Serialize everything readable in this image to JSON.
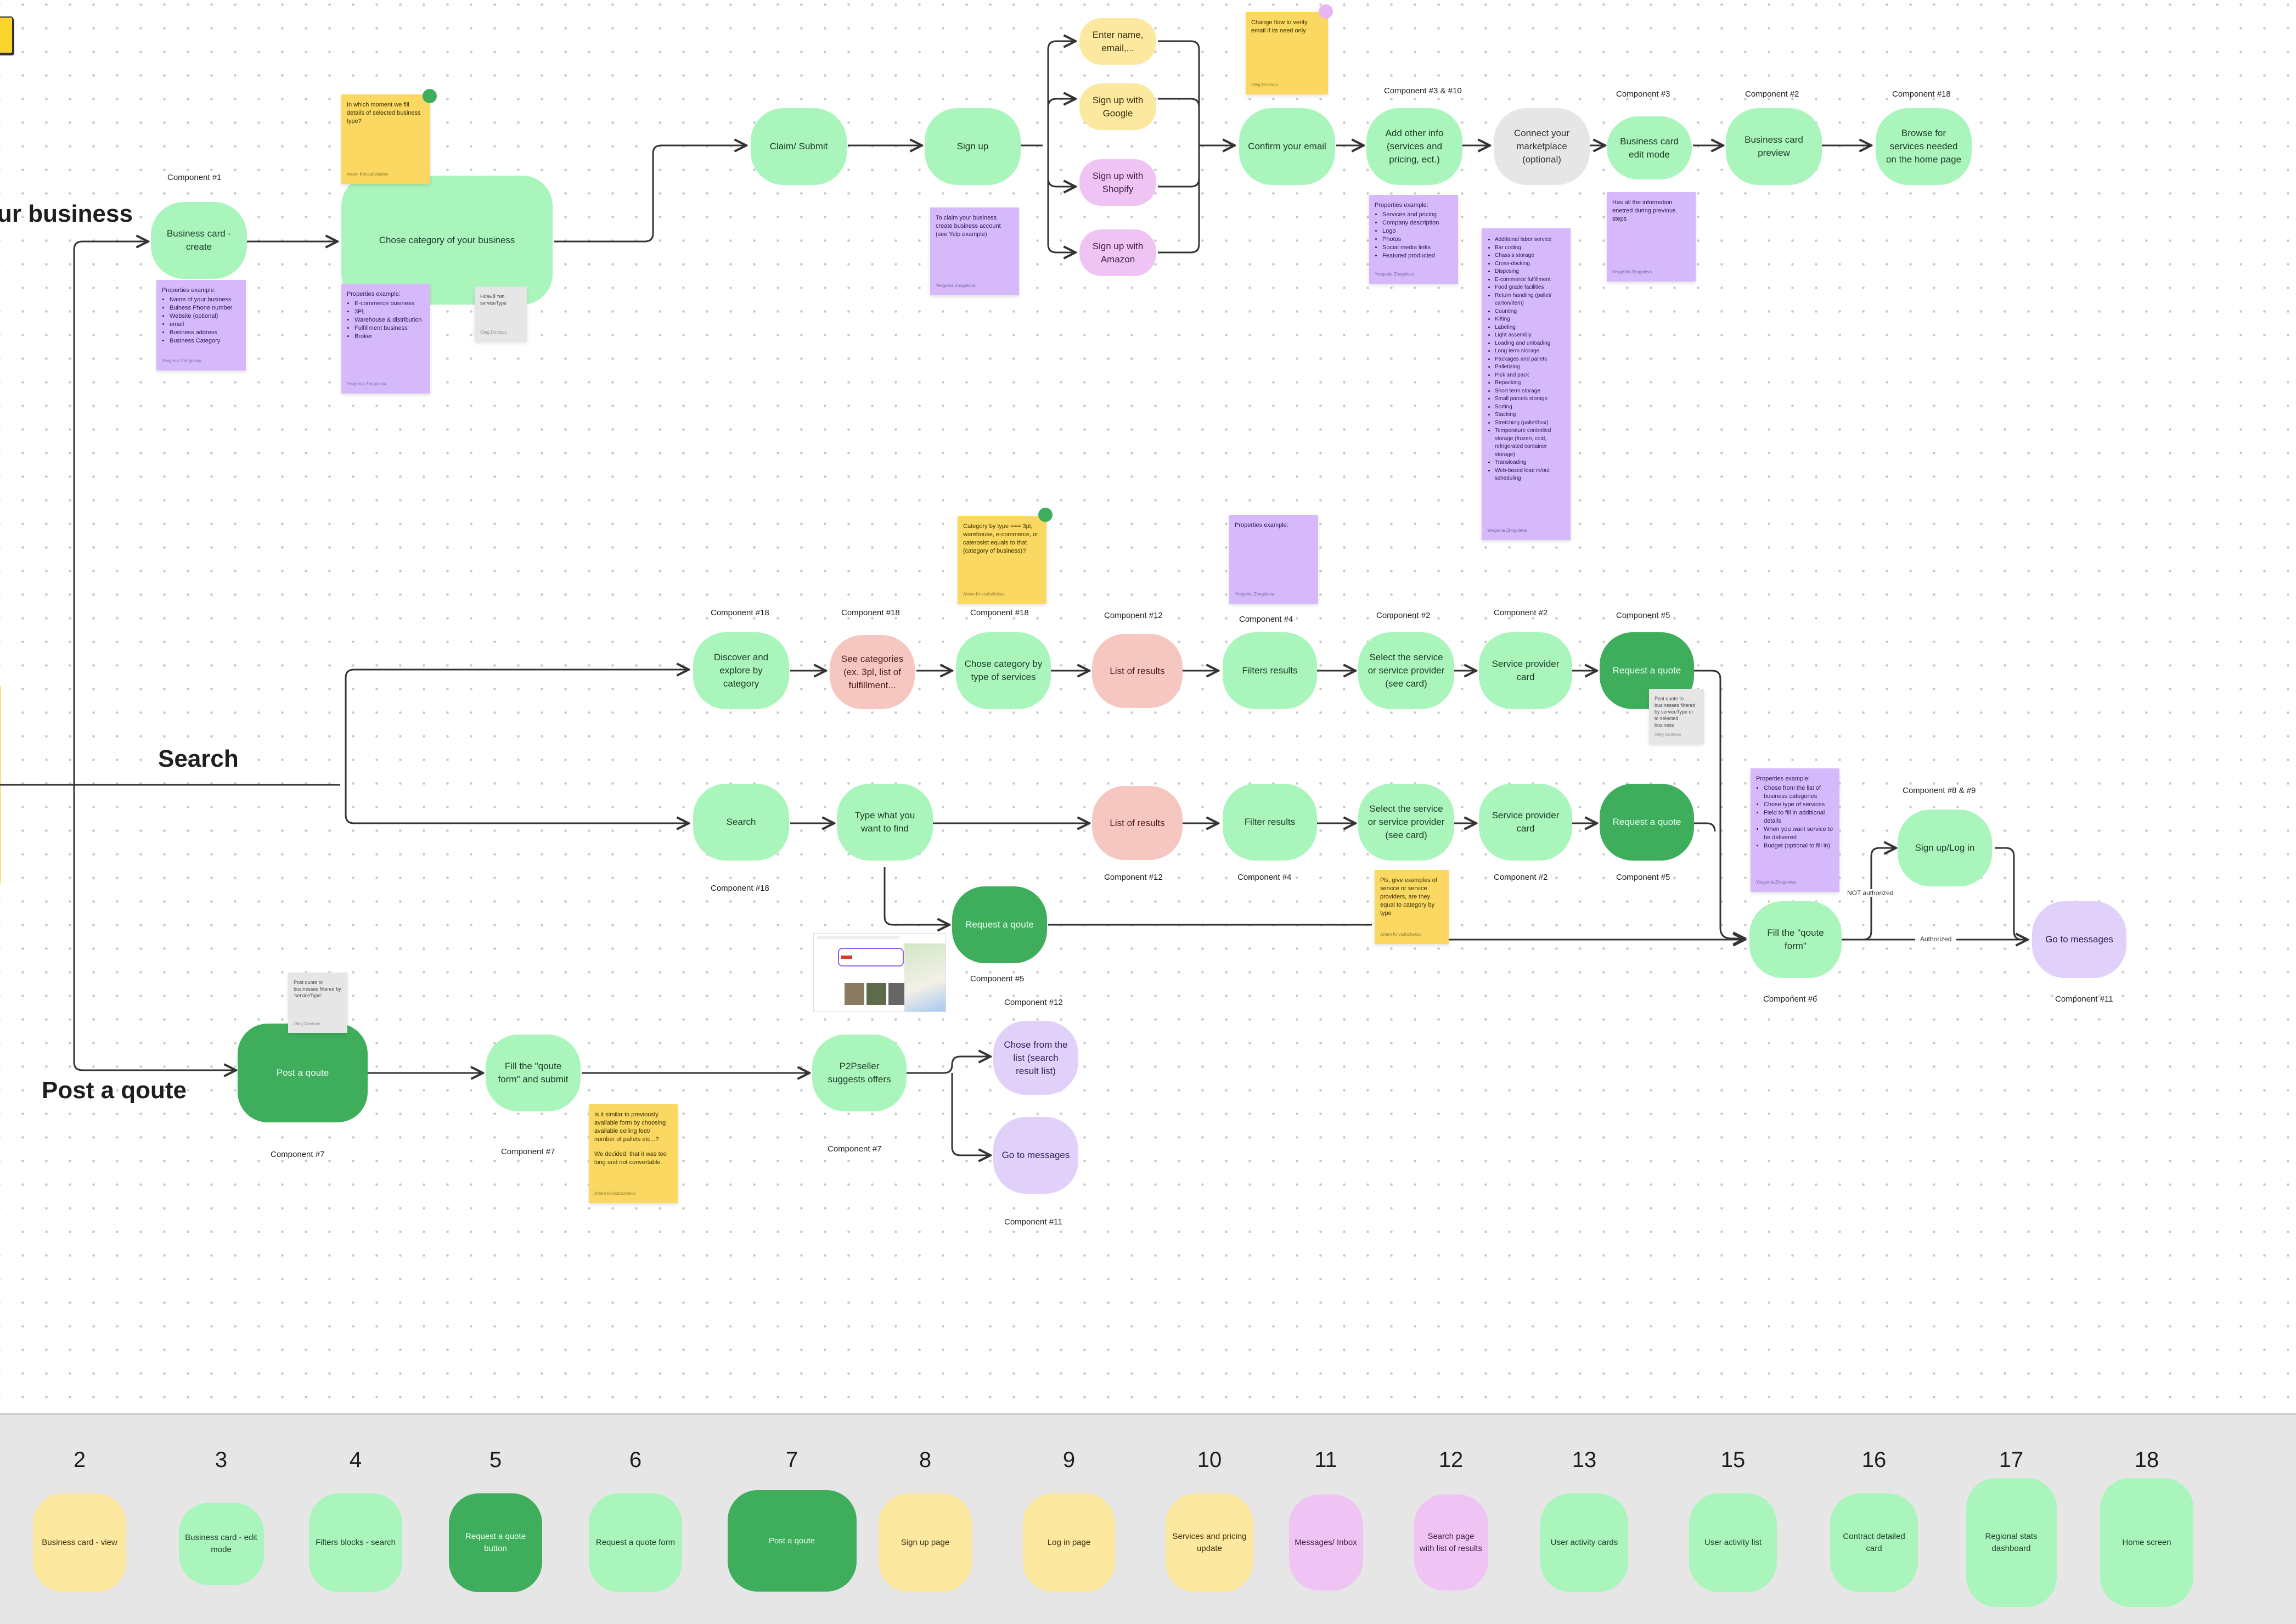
{
  "sections": {
    "claim": "ur business",
    "search": "Search",
    "post": "Post a qoute"
  },
  "flow_claim": {
    "nodes": [
      {
        "id": "bc-create",
        "label": "Business card - create",
        "component": "Component #1"
      },
      {
        "id": "chose-cat",
        "label": "Chose category of your business",
        "component": ""
      },
      {
        "id": "claim",
        "label": "Claim/ Submit",
        "component": ""
      },
      {
        "id": "signup",
        "label": "Sign up",
        "component": ""
      },
      {
        "id": "enter-name",
        "label": "Enter name, email,...",
        "component": ""
      },
      {
        "id": "google",
        "label": "Sign up with Google",
        "component": ""
      },
      {
        "id": "shopify",
        "label": "Sign up with Shopify",
        "component": ""
      },
      {
        "id": "amazon",
        "label": "Sign up with Amazon",
        "component": ""
      },
      {
        "id": "confirm",
        "label": "Confirm your email",
        "component": ""
      },
      {
        "id": "add-info",
        "label": "Add other info (services and pricing, ect.)",
        "component": "Component #3 & #10"
      },
      {
        "id": "marketplace",
        "label": "Connect your marketplace (optional)",
        "component": ""
      },
      {
        "id": "bc-edit",
        "label": "Business card edit mode",
        "component": "Component #3"
      },
      {
        "id": "bc-preview",
        "label": "Business card preview",
        "component": "Component #2"
      },
      {
        "id": "browse",
        "label": "Browse for services needed on the home page",
        "component": "Component #18"
      }
    ]
  },
  "flow_discover": {
    "nodes": [
      {
        "label": "Discover and explore by category",
        "component": "Component #18"
      },
      {
        "label": "See categories (ex. 3pl, list of fulfillment...",
        "component": "Component #18"
      },
      {
        "label": "Chose category by type of services",
        "component": "Component #18"
      },
      {
        "label": "List of results",
        "component": "Component #12"
      },
      {
        "label": "Filters results",
        "component": "Component #4"
      },
      {
        "label": "Select the service or service provider (see card)",
        "component": "Component #2"
      },
      {
        "label": "Service provider card",
        "component": "Component #2"
      },
      {
        "label": "Request a quote",
        "component": "Component #5"
      }
    ]
  },
  "flow_search": {
    "nodes": [
      {
        "label": "Search",
        "component": "Component #18"
      },
      {
        "label": "Type what you want to find",
        "component": ""
      },
      {
        "label": "List of results",
        "component": "Component #12"
      },
      {
        "label": "Filter results",
        "component": "Component #4"
      },
      {
        "label": "Select the service or service provider (see card)",
        "component": "Component #2"
      },
      {
        "label": "Service provider card",
        "component": "Component #2"
      },
      {
        "label": "Request a quote",
        "component": "Component #5"
      }
    ],
    "request_qoute": {
      "label": "Request a qoute",
      "component": "Component #5",
      "component2": "Component #12"
    },
    "fill_form": {
      "label": "Fill the \"qoute form\"",
      "component": "Component #6"
    },
    "signup_login": {
      "label": "Sign up/Log in",
      "component": "Component #8 & #9"
    },
    "go_messages": {
      "label": "Go to messages",
      "component": "Component #11"
    },
    "edge_not_auth": "NOT authorized",
    "edge_auth": "Authorized"
  },
  "flow_post": {
    "post": {
      "label": "Post a qoute",
      "component": "Component #7"
    },
    "fill": {
      "label": "Fill the \"qoute form\" and submit",
      "component": "Component #7"
    },
    "p2p": {
      "label": "P2Pseller suggests offers",
      "component": "Component #7"
    },
    "chose": {
      "label": "Chose from the list (search result list)",
      "component": "Component #12"
    },
    "messages": {
      "label": "Go to messages",
      "component": "Component #11"
    }
  },
  "stickies": {
    "q_moment": {
      "text": "In which moment we fill details of selected business type?",
      "author": "Artem Krivoshchekov"
    },
    "props_bc": {
      "title": "Properties example:",
      "items": [
        "Name of your business",
        "Buiness Phone number",
        "Website (optional)",
        "email",
        "Business address",
        "Business Category"
      ],
      "author": "Yevgenia Zhogoleva"
    },
    "props_cat": {
      "title": "Properties example:",
      "items": [
        "E-commerce business",
        "3PL",
        "Warehouse & distribution",
        "Fulfillment business",
        "Broker"
      ],
      "author": "Yevgenia Zhogoleva"
    },
    "grey_cat": {
      "text": "Новый тип serviceType",
      "author": "Oleg Dontsov"
    },
    "claim_note": {
      "text": "To claim your business create business account (see Yelp example)",
      "author": "Yevgenia Zhogoleva"
    },
    "verify_note": {
      "text": "Change flow to verify email if its need only",
      "author": "Oleg Dontsov"
    },
    "props_info": {
      "title": "Properties example:",
      "items": [
        "Services and pricing",
        "Company description",
        "Logo",
        "Photos",
        "Social media links",
        "Featured producted"
      ],
      "author": "Yevgenia Zhogoleva"
    },
    "services_list": {
      "items": [
        "Additional labor service",
        "Bar coding",
        "Chassis storage",
        "Cross-docking",
        "Disposing",
        "E-commerce fulfillment",
        "Food grade facilities",
        "Return handling (pallet/ carton/item)",
        "Counting",
        "Kitting",
        "Labeling",
        "Light assembly",
        "Loading and unloading",
        "Long term storage",
        "Packages and pallets",
        "Palletizing",
        "Pick and pack",
        "Repacking",
        "Short term storage",
        "Small parcels storage",
        "Sorting",
        "Stacking",
        "Stretching (pallet/box)",
        "Temperature controlled storage (frozen, cold, refrigerated container storage)",
        "Transloading",
        "Web-based load in/out scheduling"
      ],
      "author": "Yevgenia Zhogoleva"
    },
    "edit_note": {
      "text": "Has all the information enetred during previous steps",
      "author": "Yevgenia Zhogoleva"
    },
    "cat_type": {
      "text": "Category by type === 3pl, warehouse, e-commerce, or caterosist equals to that (category of business)?",
      "author": "Artem Krivoshchekov"
    },
    "props_filter": {
      "title": "Properties example:",
      "author": "Yevgenia Zhogoleva"
    },
    "grey_quote": {
      "text": "Post quote to businesses filtered by serviceType or to selected business",
      "author": "Oleg Dontsov"
    },
    "pls_examples": {
      "text": "Pls, give examples of service or service providers, are they equal to category by type",
      "author": "Artem Krivoshchekov"
    },
    "props_quote": {
      "title": "Properties example:",
      "items": [
        "Chose from the list of business categories",
        "Chose type of services",
        "Field to fill in additional details",
        "When you want service to be delivered",
        "Budget (optional to fill in)"
      ],
      "author": "Yevgenia Zhogoleva"
    },
    "grey_post": {
      "text": "Post quote to businesses filtered by 'serviceType'",
      "author": "Oleg Dontsov"
    },
    "similar_note": {
      "text": "Is it similar to previously available form by choosing available ceiling feet/ number of pallets etc...?",
      "text2": "We decided, that it was too long and not convertable.",
      "author": "Artem Krivoshchekov"
    }
  },
  "legend": [
    {
      "num": "2",
      "label": "Business card - view",
      "color": "yellow"
    },
    {
      "num": "3",
      "label": "Business card - edit mode",
      "color": "green"
    },
    {
      "num": "4",
      "label": "Filters blocks - search",
      "color": "green"
    },
    {
      "num": "5",
      "label": "Request a quote button",
      "color": "dark-green"
    },
    {
      "num": "6",
      "label": "Request a quote form",
      "color": "green"
    },
    {
      "num": "7",
      "label": "Post a qoute",
      "color": "dark-green"
    },
    {
      "num": "8",
      "label": "Sign up page",
      "color": "yellow"
    },
    {
      "num": "9",
      "label": "Log in page",
      "color": "yellow"
    },
    {
      "num": "10",
      "label": "Services and pricing update",
      "color": "yellow"
    },
    {
      "num": "11",
      "label": "Messages/ Inbox",
      "color": "pink"
    },
    {
      "num": "12",
      "label": "Search page with list of results",
      "color": "pink"
    },
    {
      "num": "13",
      "label": "User activity cards",
      "color": "green"
    },
    {
      "num": "15",
      "label": "User activity list",
      "color": "green"
    },
    {
      "num": "16",
      "label": "Contract detailed card",
      "color": "green"
    },
    {
      "num": "17",
      "label": "Regional stats dashboard",
      "color": "green"
    },
    {
      "num": "18",
      "label": "Home screen",
      "color": "green"
    }
  ],
  "colors": {
    "green": "#a9f5bb",
    "dark_green": "#3fae5c",
    "yellow": "#fde8a0",
    "pink": "#f6c6c0",
    "violet": "#e0d0fa",
    "magenta": "#efc4f5",
    "sticky_yellow": "#fbd862",
    "sticky_violet": "#d6b9fb"
  }
}
